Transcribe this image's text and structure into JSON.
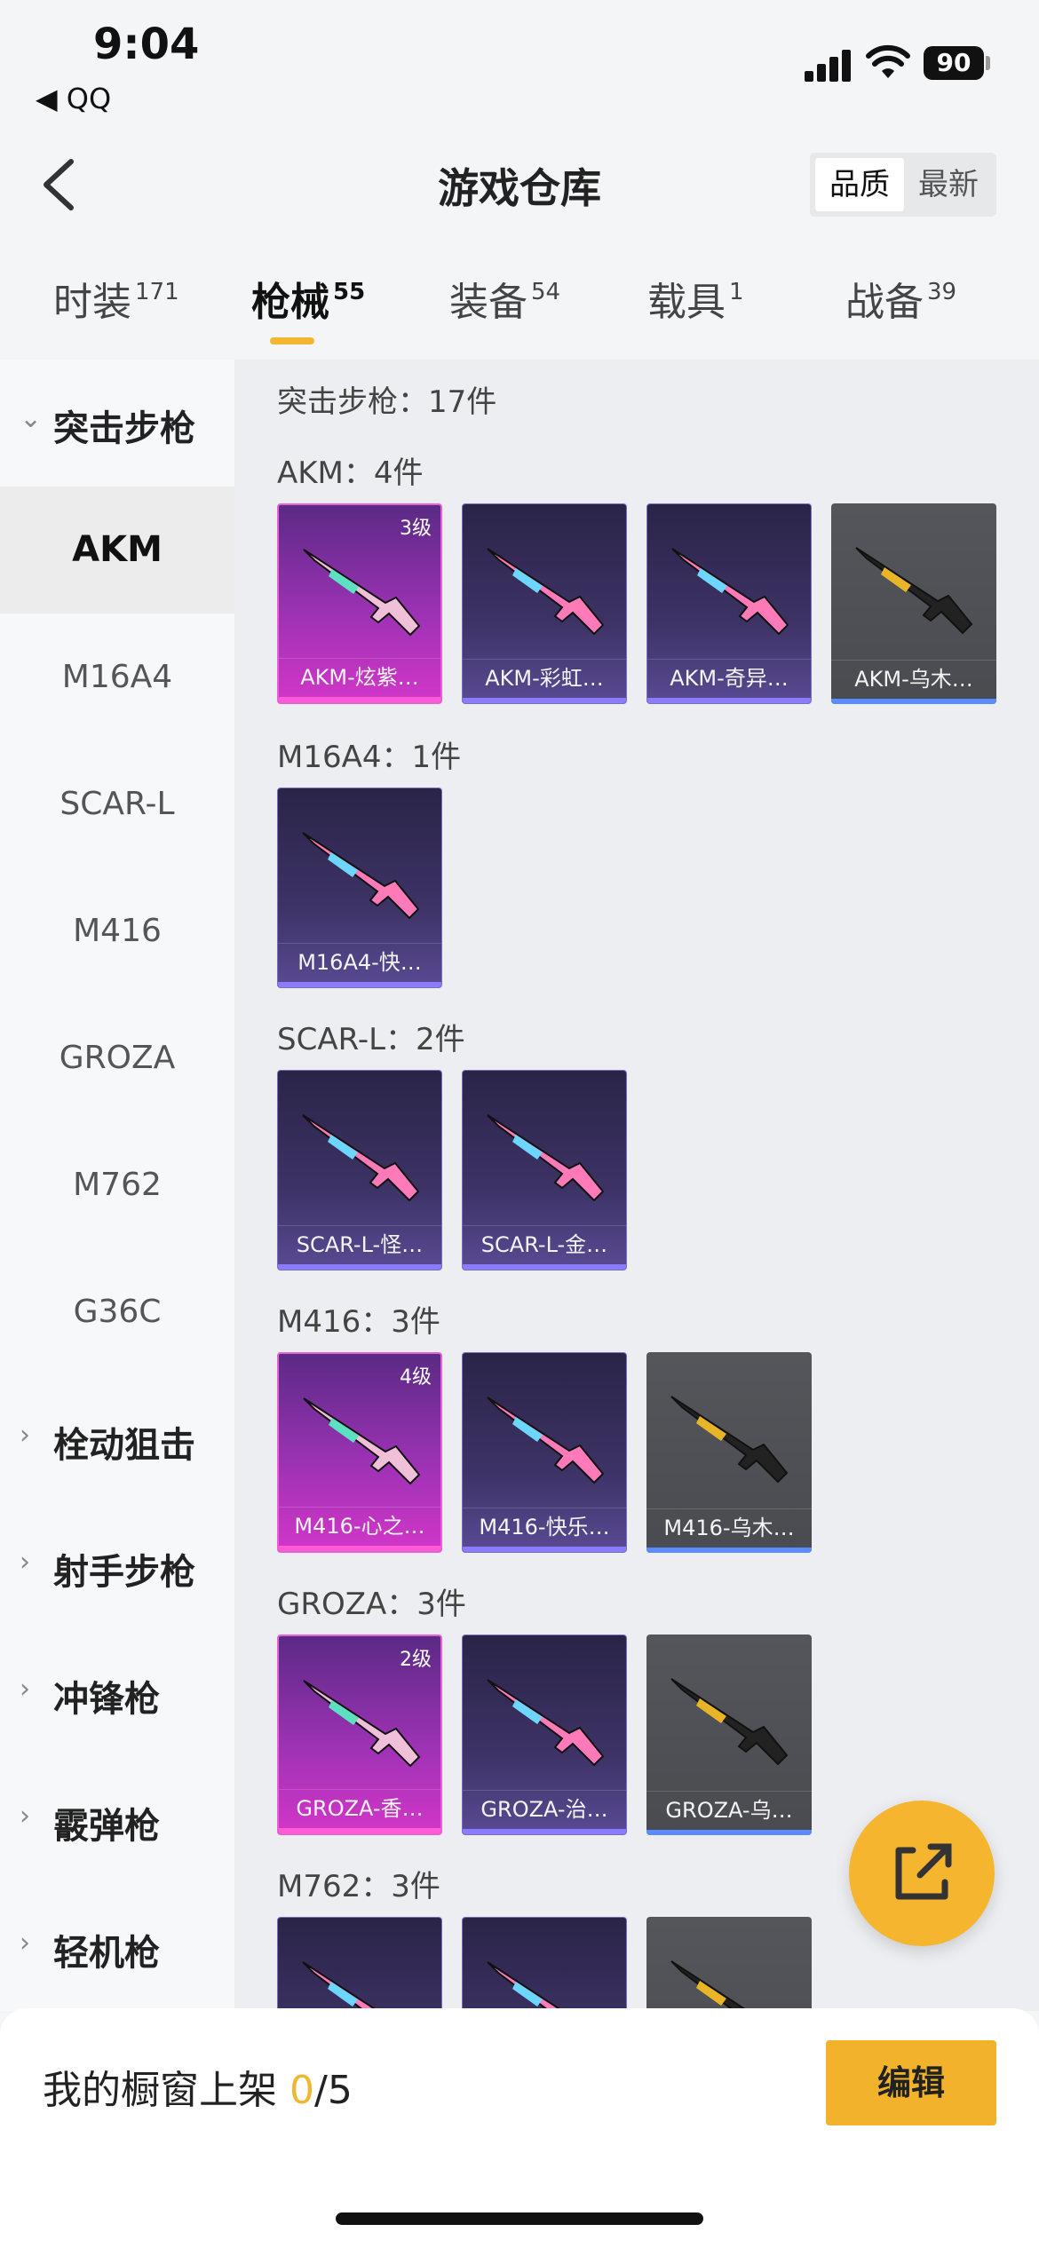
{
  "status": {
    "time": "9:04",
    "back_app": "◀ QQ",
    "battery": "90"
  },
  "header": {
    "title": "游戏仓库",
    "sort_quality": "品质",
    "sort_newest": "最新"
  },
  "tabs": [
    {
      "label": "时装",
      "count": "171"
    },
    {
      "label": "枪械",
      "count": "55",
      "active": true
    },
    {
      "label": "装备",
      "count": "54"
    },
    {
      "label": "载具",
      "count": "1"
    },
    {
      "label": "战备",
      "count": "39"
    }
  ],
  "sidebar": {
    "expanded_group": "突击步枪",
    "items": [
      "AKM",
      "M16A4",
      "SCAR-L",
      "M416",
      "GROZA",
      "M762",
      "G36C"
    ],
    "active_item": "AKM",
    "groups": [
      "栓动狙击",
      "射手步枪",
      "冲锋枪",
      "霰弹枪",
      "轻机枪"
    ]
  },
  "main": {
    "total": "突击步枪：17件",
    "sections": [
      {
        "header": "AKM：4件",
        "items": [
          {
            "name": "AKM-炫紫…",
            "level": "3级",
            "rarity": "pink"
          },
          {
            "name": "AKM-彩虹…",
            "rarity": "purple"
          },
          {
            "name": "AKM-奇异…",
            "rarity": "purple"
          },
          {
            "name": "AKM-乌木…",
            "rarity": "gray"
          }
        ]
      },
      {
        "header": "M16A4：1件",
        "items": [
          {
            "name": "M16A4-快…",
            "rarity": "purple"
          }
        ]
      },
      {
        "header": "SCAR-L：2件",
        "items": [
          {
            "name": "SCAR-L-怪…",
            "rarity": "purple"
          },
          {
            "name": "SCAR-L-金…",
            "rarity": "purple"
          }
        ]
      },
      {
        "header": "M416：3件",
        "items": [
          {
            "name": "M416-心之…",
            "level": "4级",
            "rarity": "pink"
          },
          {
            "name": "M416-快乐…",
            "rarity": "purple"
          },
          {
            "name": "M416-乌木…",
            "rarity": "gray"
          }
        ]
      },
      {
        "header": "GROZA：3件",
        "items": [
          {
            "name": "GROZA-香…",
            "level": "2级",
            "rarity": "pink"
          },
          {
            "name": "GROZA-治…",
            "rarity": "purple"
          },
          {
            "name": "GROZA-乌…",
            "rarity": "gray"
          }
        ]
      },
      {
        "header": "M762：3件",
        "items": [
          {
            "name": "",
            "rarity": "purple"
          },
          {
            "name": "",
            "rarity": "purple"
          },
          {
            "name": "",
            "rarity": "gray"
          }
        ]
      }
    ]
  },
  "bottom": {
    "shelf_label": "我的橱窗上架",
    "shelf_count": "0",
    "shelf_total": "/5",
    "edit": "编辑"
  },
  "colors": {
    "accent": "#f2b22b",
    "pink_rarity": "#ff5ad8",
    "purple_rarity": "#8a7cff",
    "gray_rarity": "#5a8cff"
  },
  "icons": [
    "chevron-left-icon",
    "chevron-down-icon",
    "chevron-right-icon",
    "share-external-icon"
  ]
}
